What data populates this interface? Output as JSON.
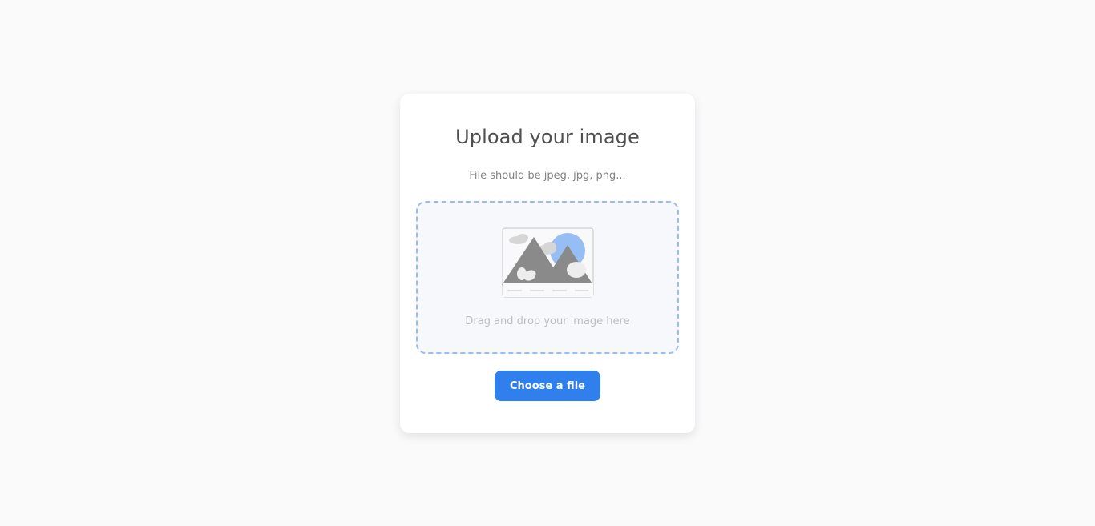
{
  "card": {
    "title": "Upload your image",
    "subtitle": "File should be jpeg, jpg, png...",
    "dropzone": {
      "illustration_icon": "image-placeholder-icon",
      "text": "Drag and drop your image here"
    },
    "choose_button_label": "Choose a file"
  },
  "colors": {
    "accent": "#2f80ed",
    "dropzone_border": "#97bef4",
    "dropzone_bg": "#f6f8fb",
    "page_bg": "#fafafb",
    "title_text": "#4f4f4f",
    "muted_text": "#828282",
    "placeholder_text": "#bdbdbd"
  }
}
